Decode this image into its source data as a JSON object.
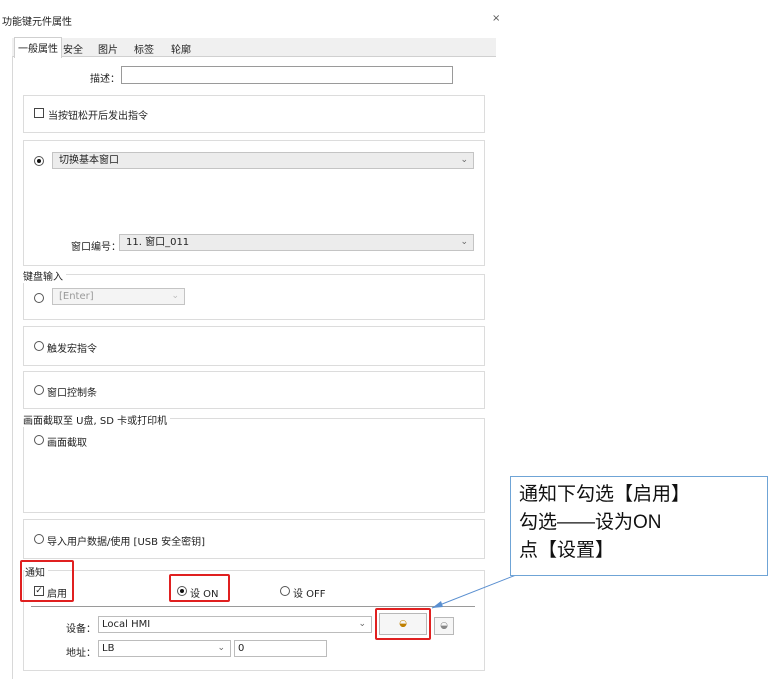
{
  "window": {
    "title": "功能键元件属性",
    "close_label": "×"
  },
  "tabs": [
    {
      "label": "一般属性",
      "active": true
    },
    {
      "label": "安全",
      "active": false
    },
    {
      "label": "图片",
      "active": false
    },
    {
      "label": "标签",
      "active": false
    },
    {
      "label": "轮廓",
      "active": false
    }
  ],
  "description": {
    "label": "描述：",
    "value": ""
  },
  "release_option": {
    "label": "当按钮松开后发出指令",
    "checked": false
  },
  "switch_window": {
    "label": "切换基本窗口",
    "selected": true,
    "window_no_label": "窗口编号：",
    "window_no_value": "11. 窗口_011"
  },
  "keyboard": {
    "legend": "键盘输入",
    "value": "[Enter]"
  },
  "macro": {
    "label": "触发宏指令"
  },
  "window_bar": {
    "label": "窗口控制条"
  },
  "screenshot": {
    "legend": "画面截取至 U盘, SD 卡或打印机",
    "label": "画面截取"
  },
  "import": {
    "label": "导入用户数据/使用 [USB 安全密钥]"
  },
  "notify": {
    "legend": "通知",
    "enable_label": "启用",
    "enable_checked": true,
    "set_on_label": "设 ON",
    "set_off_label": "设 OFF",
    "device_label": "设备：",
    "device_value": "Local HMI",
    "address_label": "地址：",
    "address_type": "LB",
    "address_value": "0"
  },
  "callout": {
    "line1": "通知下勾选【启用】",
    "line2": "勾选——设为ON",
    "line3": "点【设置】"
  },
  "colors": {
    "highlight": "#e02020",
    "callout_border": "#6fa4d6"
  }
}
